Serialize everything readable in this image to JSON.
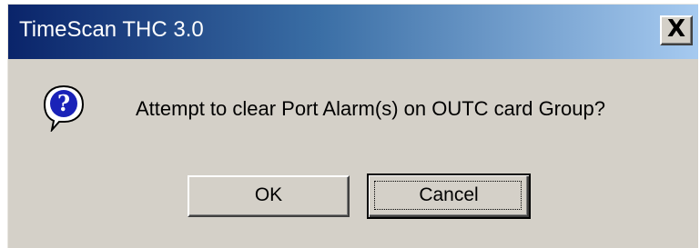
{
  "window": {
    "title": "TimeScan THC 3.0",
    "close_glyph": "X"
  },
  "dialog": {
    "icon": "question-icon",
    "message": "Attempt to clear Port Alarm(s) on OUTC card Group?"
  },
  "buttons": {
    "ok_label": "OK",
    "cancel_label": "Cancel"
  },
  "colors": {
    "titlebar_start": "#0a246a",
    "titlebar_end": "#a6caf0",
    "dialog_bg": "#d4d0c8"
  }
}
